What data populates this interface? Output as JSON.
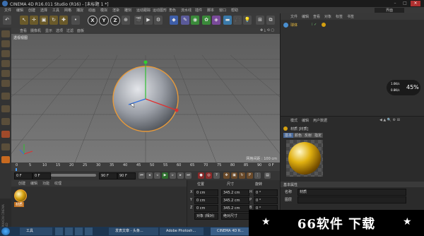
{
  "window": {
    "title": "CINEMA 4D R16.011 Studio (R16) - [未标题 1 *]"
  },
  "menubar": {
    "items": [
      "文件",
      "编辑",
      "创建",
      "选择",
      "工具",
      "网格",
      "捕捉",
      "动画",
      "模拟",
      "渲染",
      "雕刻",
      "运动跟踪",
      "运动图形",
      "角色",
      "流水线",
      "插件",
      "脚本",
      "窗口",
      "帮助"
    ],
    "layout_label": "界面"
  },
  "toolbar": {
    "axis_x": "X",
    "axis_y": "Y",
    "axis_z": "Z"
  },
  "viewport": {
    "menu": [
      "查看",
      "摄像机",
      "显示",
      "选项",
      "过滤",
      "面板"
    ],
    "label": "透视视图",
    "grid_info": "网格间距 : 100 cm"
  },
  "timeline": {
    "ticks": [
      "0",
      "5",
      "10",
      "15",
      "20",
      "25",
      "30",
      "35",
      "40",
      "45",
      "50",
      "55",
      "60",
      "65",
      "70",
      "75",
      "80",
      "85",
      "90"
    ],
    "end_label": "0 F"
  },
  "playbar": {
    "start": "0 F",
    "current": "0 F",
    "end": "90 F",
    "end2": "90 F"
  },
  "material_manager": {
    "menu": [
      "创建",
      "编辑",
      "功能",
      "纹理"
    ],
    "material_name": "材质"
  },
  "coords": {
    "headers": [
      "位置",
      "尺寸",
      "旋转"
    ],
    "rows": [
      {
        "axis": "X",
        "pos": "0 cm",
        "size": "345.2 cm",
        "rot_axis": "H",
        "rot": "0 °"
      },
      {
        "axis": "Y",
        "pos": "0 cm",
        "size": "345.2 cm",
        "rot_axis": "P",
        "rot": "0 °"
      },
      {
        "axis": "Z",
        "pos": "0 cm",
        "size": "345.2 cm",
        "rot_axis": "B",
        "rot": "0 °"
      }
    ],
    "mode_label": "对象 (相对)",
    "size_mode": "绝对尺寸",
    "apply_label": "应用"
  },
  "object_manager": {
    "menu": [
      "文件",
      "编辑",
      "查看",
      "对象",
      "标签",
      "书签"
    ],
    "object_name": "球体"
  },
  "attributes": {
    "menu": [
      "模式",
      "编辑",
      "用户数据"
    ],
    "material_title": "材质 [材质]",
    "tabs": [
      "基本",
      "颜色",
      "反射",
      "指定"
    ],
    "section_basic": "基本属性",
    "name_label": "名称",
    "name_value": "材质",
    "layer_label": "图层"
  },
  "hud": {
    "zoom_percent": "45%",
    "rate_up": "1.6K/s",
    "rate_down": "0.8K/s"
  },
  "watermark": {
    "text": "66软件 下载",
    "star": "★"
  },
  "taskbar": {
    "items": [
      {
        "label": "工具"
      },
      {
        "label": "发表文章 - 头条..."
      },
      {
        "label": "Adobe Photosh..."
      },
      {
        "label": "CINEMA 4D R..."
      }
    ]
  },
  "side_brand": "MAXON CINEMA 4D",
  "colors": {
    "accent": "#f0a030",
    "sphere": "#b8bcc4",
    "axis_x": "#e03030",
    "axis_y": "#30c030",
    "axis_z": "#3070e0"
  }
}
